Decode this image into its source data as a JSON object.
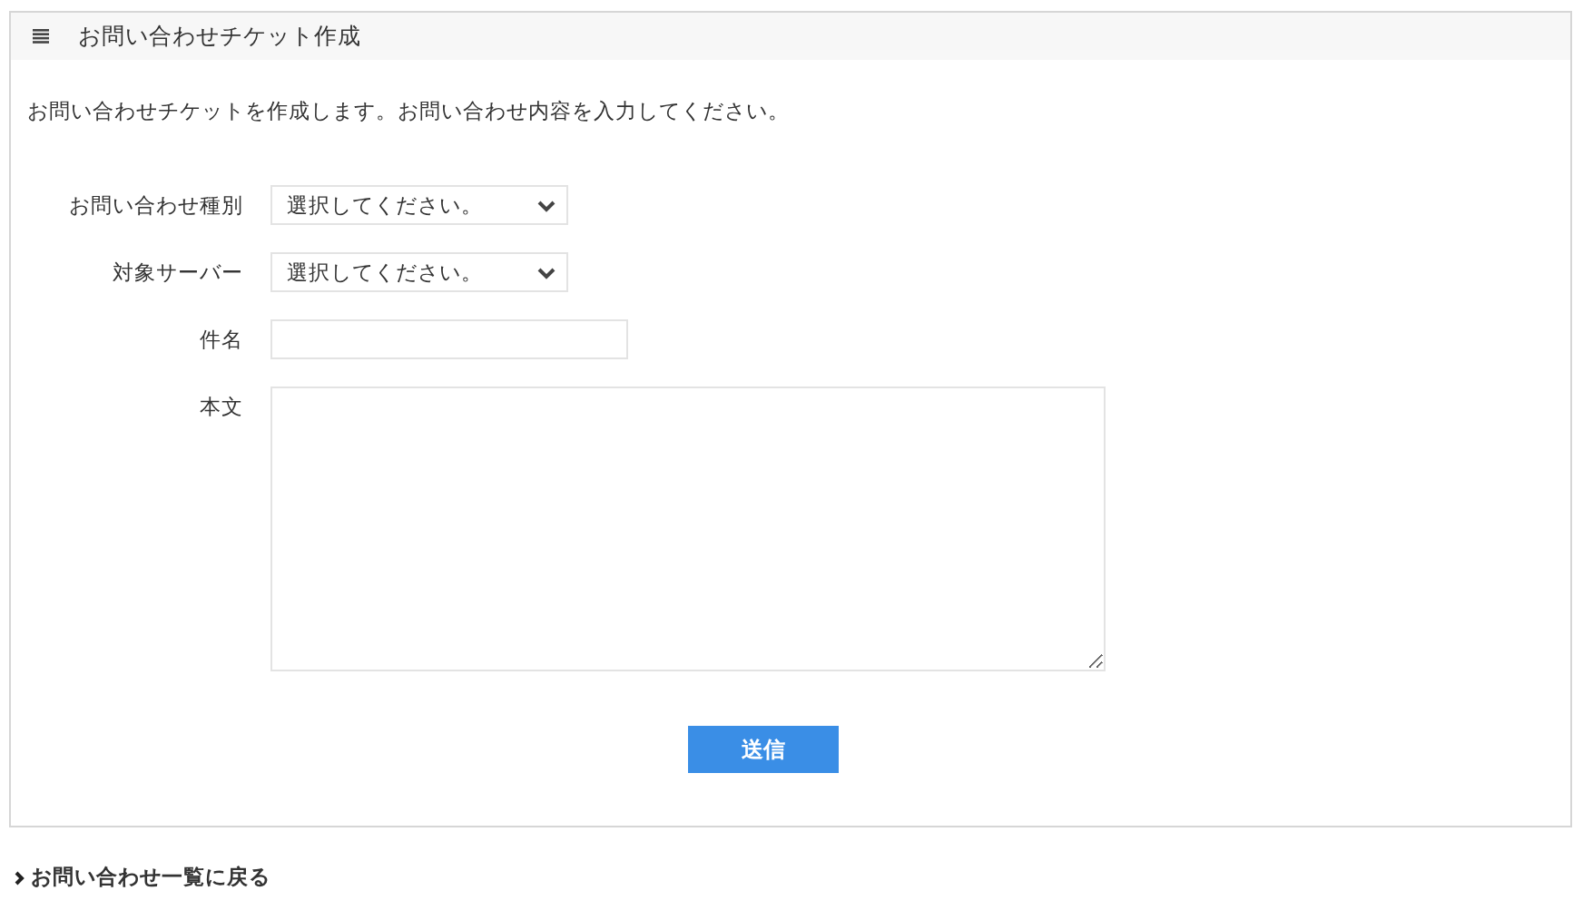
{
  "panel": {
    "title": "お問い合わせチケット作成"
  },
  "intro": "お問い合わせチケットを作成します。お問い合わせ内容を入力してください。",
  "fields": [
    {
      "kind": "select",
      "label": "お問い合わせ種別",
      "value": "選択してください。"
    },
    {
      "kind": "select",
      "label": "対象サーバー",
      "value": "選択してください。"
    },
    {
      "kind": "text",
      "label": "件名"
    },
    {
      "kind": "textarea",
      "label": "本文"
    }
  ],
  "submit": "送信",
  "back_link": "お問い合わせ一覧に戻る"
}
